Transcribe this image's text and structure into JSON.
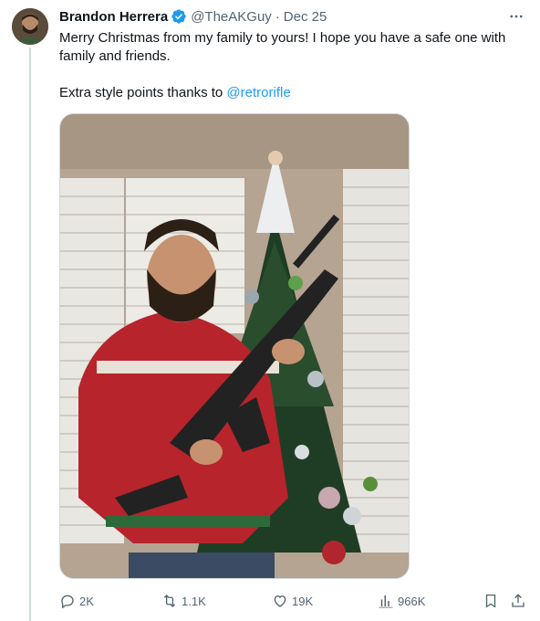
{
  "tweet": {
    "author_name": "Brandon Herrera",
    "handle": "@TheAKGuy",
    "separator": "·",
    "date": "Dec 25",
    "text_line1": "Merry Christmas from my family to yours! I hope you have a safe one with family and friends.",
    "text_line2_prefix": "Extra style points thanks to ",
    "mention": "@retrorifle"
  },
  "actions": {
    "replies": "2K",
    "reposts": "1.1K",
    "likes": "19K",
    "views": "966K"
  },
  "colors": {
    "accent": "#1d9bf0",
    "muted": "#536471",
    "text": "#0f1419"
  }
}
